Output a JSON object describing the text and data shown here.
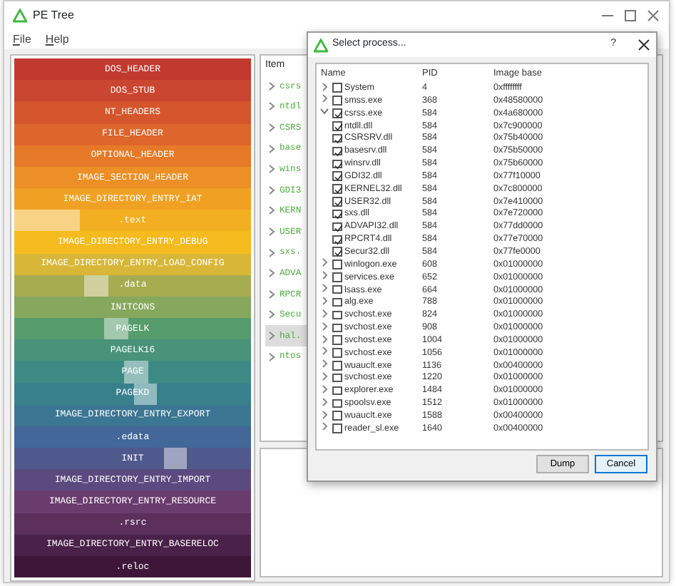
{
  "window": {
    "title": "PE Tree",
    "menu": [
      "File",
      "Help"
    ]
  },
  "map": {
    "bands": [
      {
        "label": "DOS_HEADER",
        "color": "#c2392f",
        "highlighted": false
      },
      {
        "label": "DOS_STUB",
        "color": "#cb4630",
        "highlighted": false
      },
      {
        "label": "NT_HEADERS",
        "color": "#d5552d",
        "highlighted": false
      },
      {
        "label": "FILE_HEADER",
        "color": "#de652b",
        "highlighted": false
      },
      {
        "label": "OPTIONAL_HEADER",
        "color": "#e67a28",
        "highlighted": false
      },
      {
        "label": "IMAGE_SECTION_HEADER",
        "color": "#ec8f26",
        "highlighted": false
      },
      {
        "label": "IMAGE_DIRECTORY_ENTRY_IAT",
        "color": "#f0a124",
        "highlighted": false
      },
      {
        "label": ".text",
        "color": "#f3af22",
        "highlighted": true
      },
      {
        "label": "IMAGE_DIRECTORY_ENTRY_DEBUG",
        "color": "#f5bb1e",
        "highlighted": false
      },
      {
        "label": "IMAGE_DIRECTORY_ENTRY_LOAD_CONFIG",
        "color": "#d8b638",
        "highlighted": false
      },
      {
        "label": ".data",
        "color": "#a6ac50",
        "highlighted": true
      },
      {
        "label": "INITCONS",
        "color": "#86a85c",
        "highlighted": false
      },
      {
        "label": "PAGELK",
        "color": "#579c6c",
        "highlighted": true
      },
      {
        "label": "PAGELK16",
        "color": "#48937a",
        "highlighted": false
      },
      {
        "label": "PAGE",
        "color": "#3d8a85",
        "highlighted": true
      },
      {
        "label": "PAGEKD",
        "color": "#38808c",
        "highlighted": true
      },
      {
        "label": "IMAGE_DIRECTORY_ENTRY_EXPORT",
        "color": "#3b7693",
        "highlighted": false
      },
      {
        "label": ".edata",
        "color": "#426798",
        "highlighted": false
      },
      {
        "label": "INIT",
        "color": "#50598e",
        "highlighted": true
      },
      {
        "label": "IMAGE_DIRECTORY_ENTRY_IMPORT",
        "color": "#5b4a80",
        "highlighted": false
      },
      {
        "label": "IMAGE_DIRECTORY_ENTRY_RESOURCE",
        "color": "#6a3c6e",
        "highlighted": false
      },
      {
        "label": ".rsrc",
        "color": "#5c2f5d",
        "highlighted": false
      },
      {
        "label": "IMAGE_DIRECTORY_ENTRY_BASERELOC",
        "color": "#4a2149",
        "highlighted": false
      },
      {
        "label": ".reloc",
        "color": "#3e1639",
        "highlighted": false
      }
    ]
  },
  "tree": {
    "column": "Item",
    "items": [
      {
        "label": "csrs",
        "selected": false
      },
      {
        "label": "ntdl",
        "selected": false
      },
      {
        "label": "CSRS",
        "selected": false
      },
      {
        "label": "base",
        "selected": false
      },
      {
        "label": "wins",
        "selected": false
      },
      {
        "label": "GDI3",
        "selected": false
      },
      {
        "label": "KERN",
        "selected": false
      },
      {
        "label": "USER",
        "selected": false
      },
      {
        "label": "sxs.",
        "selected": false
      },
      {
        "label": "ADVA",
        "selected": false
      },
      {
        "label": "RPCR",
        "selected": false
      },
      {
        "label": "Secu",
        "selected": false
      },
      {
        "label": "hal.",
        "selected": true
      },
      {
        "label": "ntos",
        "selected": false
      }
    ]
  },
  "dialog": {
    "title": "Select process...",
    "help": "?",
    "columns": [
      "Name",
      "PID",
      "Image base"
    ],
    "rows": [
      {
        "name": "System",
        "pid": "4",
        "image_base": "0xffffffff",
        "checked": false,
        "expanded": false
      },
      {
        "name": "smss.exe",
        "pid": "368",
        "image_base": "0x48580000",
        "checked": false,
        "expanded": false
      },
      {
        "name": "csrss.exe",
        "pid": "584",
        "image_base": "0x4a680000",
        "checked": true,
        "expanded": true,
        "children": [
          {
            "name": "ntdll.dll",
            "pid": "584",
            "image_base": "0x7c900000",
            "checked": true
          },
          {
            "name": "CSRSRV.dll",
            "pid": "584",
            "image_base": "0x75b40000",
            "checked": true
          },
          {
            "name": "basesrv.dll",
            "pid": "584",
            "image_base": "0x75b50000",
            "checked": true
          },
          {
            "name": "winsrv.dll",
            "pid": "584",
            "image_base": "0x75b60000",
            "checked": true
          },
          {
            "name": "GDI32.dll",
            "pid": "584",
            "image_base": "0x77f10000",
            "checked": true
          },
          {
            "name": "KERNEL32.dll",
            "pid": "584",
            "image_base": "0x7c800000",
            "checked": true
          },
          {
            "name": "USER32.dll",
            "pid": "584",
            "image_base": "0x7e410000",
            "checked": true
          },
          {
            "name": "sxs.dll",
            "pid": "584",
            "image_base": "0x7e720000",
            "checked": true
          },
          {
            "name": "ADVAPI32.dll",
            "pid": "584",
            "image_base": "0x77dd0000",
            "checked": true
          },
          {
            "name": "RPCRT4.dll",
            "pid": "584",
            "image_base": "0x77e70000",
            "checked": true
          },
          {
            "name": "Secur32.dll",
            "pid": "584",
            "image_base": "0x77fe0000",
            "checked": true
          }
        ]
      },
      {
        "name": "winlogon.exe",
        "pid": "608",
        "image_base": "0x01000000",
        "checked": false,
        "expanded": false
      },
      {
        "name": "services.exe",
        "pid": "652",
        "image_base": "0x01000000",
        "checked": false,
        "expanded": false
      },
      {
        "name": "lsass.exe",
        "pid": "664",
        "image_base": "0x01000000",
        "checked": false,
        "expanded": false
      },
      {
        "name": "alg.exe",
        "pid": "788",
        "image_base": "0x01000000",
        "checked": false,
        "expanded": false
      },
      {
        "name": "svchost.exe",
        "pid": "824",
        "image_base": "0x01000000",
        "checked": false,
        "expanded": false
      },
      {
        "name": "svchost.exe",
        "pid": "908",
        "image_base": "0x01000000",
        "checked": false,
        "expanded": false
      },
      {
        "name": "svchost.exe",
        "pid": "1004",
        "image_base": "0x01000000",
        "checked": false,
        "expanded": false
      },
      {
        "name": "svchost.exe",
        "pid": "1056",
        "image_base": "0x01000000",
        "checked": false,
        "expanded": false
      },
      {
        "name": "wuauclt.exe",
        "pid": "1136",
        "image_base": "0x00400000",
        "checked": false,
        "expanded": false
      },
      {
        "name": "svchost.exe",
        "pid": "1220",
        "image_base": "0x01000000",
        "checked": false,
        "expanded": false
      },
      {
        "name": "explorer.exe",
        "pid": "1484",
        "image_base": "0x01000000",
        "checked": false,
        "expanded": false
      },
      {
        "name": "spoolsv.exe",
        "pid": "1512",
        "image_base": "0x01000000",
        "checked": false,
        "expanded": false
      },
      {
        "name": "wuauclt.exe",
        "pid": "1588",
        "image_base": "0x00400000",
        "checked": false,
        "expanded": false
      },
      {
        "name": "reader_sl.exe",
        "pid": "1640",
        "image_base": "0x00400000",
        "checked": false,
        "expanded": false
      }
    ],
    "buttons": [
      {
        "label": "Dump",
        "kind": "secondary"
      },
      {
        "label": "Cancel",
        "kind": "default"
      }
    ]
  }
}
